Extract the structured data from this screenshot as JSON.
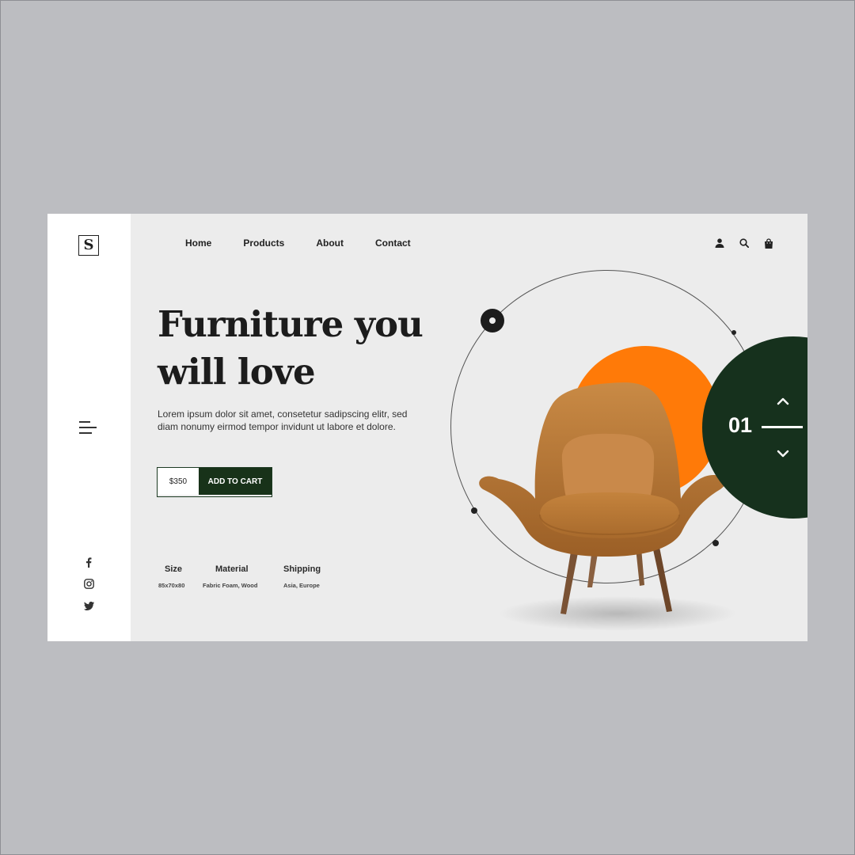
{
  "brand": {
    "logo_letter": "S"
  },
  "nav": {
    "items": [
      {
        "label": "Home"
      },
      {
        "label": "Products"
      },
      {
        "label": "About"
      },
      {
        "label": "Contact"
      }
    ]
  },
  "header_icons": [
    "user-icon",
    "search-icon",
    "shopping-bag-icon"
  ],
  "hero": {
    "headline_line1": "Furniture you",
    "headline_line2": "will love",
    "description": "Lorem ipsum dolor sit amet, consetetur sadipscing elitr, sed diam nonumy eirmod tempor invidunt ut labore et dolore.",
    "price": "$350",
    "cta_label": "ADD TO CART"
  },
  "specs": [
    {
      "label": "Size",
      "value": "85x70x80"
    },
    {
      "label": "Material",
      "value": "Fabric Foam, Wood"
    },
    {
      "label": "Shipping",
      "value": "Asia, Europe"
    }
  ],
  "slider": {
    "current": "01"
  },
  "social_icons": [
    "facebook-icon",
    "instagram-icon",
    "twitter-icon"
  ],
  "colors": {
    "accent_orange": "#ff7a08",
    "accent_green": "#16311d",
    "page_bg": "#ececec",
    "outer_bg": "#bcbdc1",
    "chair": "#b8783a"
  }
}
